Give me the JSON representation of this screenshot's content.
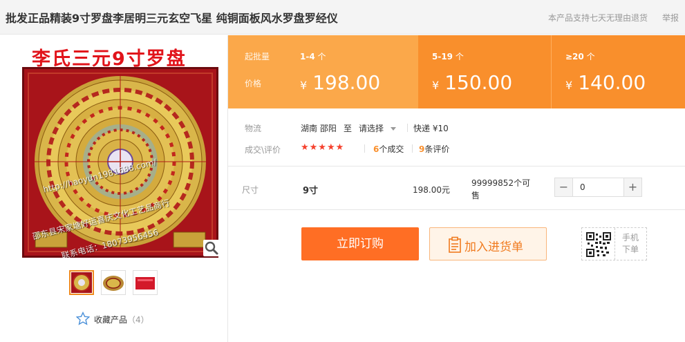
{
  "header": {
    "title": "批发正品精装9寸罗盘李居明三元玄空飞星 纯铜面板风水罗盘罗经仪",
    "return_policy": "本产品支持七天无理由退货",
    "report": "举报"
  },
  "gallery": {
    "banner_text": "李氏三元9寸罗盘",
    "watermark_url": "http://haoyun1981688.com/",
    "watermark_company": "邵东县宋家塘好运喜庆文化工艺品商行",
    "watermark_phone": "联系电话：18073956456",
    "thumbnail_count": 3,
    "favorite_label": "收藏产品",
    "favorite_count": "（4）"
  },
  "pricing": {
    "qty_header": "起批量",
    "price_header": "价格",
    "currency": "¥",
    "tiers": [
      {
        "qty": "1-4",
        "unit": "个",
        "price": "198.00"
      },
      {
        "qty": "5-19",
        "unit": "个",
        "price": "150.00"
      },
      {
        "qty": "≥20",
        "unit": "个",
        "price": "140.00"
      }
    ]
  },
  "logistics": {
    "label": "物流",
    "origin": "湖南 邵阳",
    "to": "至",
    "destination": "请选择",
    "shipping": "快递 ¥10"
  },
  "transactions": {
    "label": "成交\\评价",
    "stars": "★★★★★",
    "deals_count": "6",
    "deals_label": "个成交",
    "reviews_count": "9",
    "reviews_label": "条评价"
  },
  "sku": {
    "label": "尺寸",
    "name": "9寸",
    "price": "198.00元",
    "stock": "99999852个可售",
    "quantity": "0"
  },
  "actions": {
    "order": "立即订购",
    "add_to_cart": "加入进货单",
    "mobile_order": "手机下单"
  },
  "colors": {
    "accent_orange": "#ff6e24",
    "price_band_light": "#fba84a",
    "price_band_dark": "#f98f2c",
    "star_red": "#f5422e"
  }
}
